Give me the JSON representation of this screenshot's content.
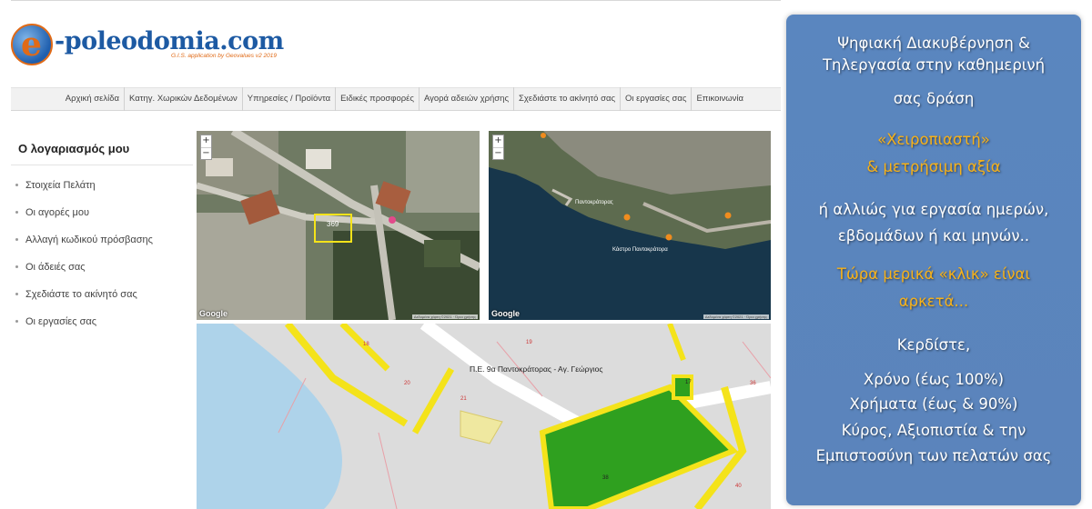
{
  "logo": {
    "text": "-poleodomia.com",
    "tagline": "G.I.S. application by Geovalues v2 2019"
  },
  "nav": {
    "items": [
      "Αρχική σελίδα",
      "Κατηγ. Χωρικών Δεδομένων",
      "Υπηρεσίες / Προϊόντα",
      "Ειδικές προσφορές",
      "Αγορά αδειών χρήσης",
      "Σχεδιάστε το ακίνητό σας",
      "Οι εργασίες σας",
      "Επικοινωνία"
    ]
  },
  "sidebar": {
    "title": "Ο λογαριασμός μου",
    "items": [
      "Στοιχεία Πελάτη",
      "Οι αγορές μου",
      "Αλλαγή κωδικού πρόσβασης",
      "Οι άδειές σας",
      "Σχεδιάστε το ακίνητό σας",
      "Οι εργασίες σας"
    ]
  },
  "maps": {
    "zoom_in": "+",
    "zoom_out": "−",
    "google": "Google",
    "attribution": "Δεδομένα χάρτη ©2021 · Όροι χρήσης",
    "satellite_left": {
      "parcel_number": "369"
    },
    "satellite_right": {
      "labels": [
        "Παντοκράτορας",
        "Κάστρο Παντοκράτορα"
      ]
    },
    "cadastral": {
      "area_label": "Π.Ε. 9α Παντοκράτορας - Αγ. Γεώργιος",
      "parcels": [
        "18",
        "19",
        "20",
        "21",
        "17",
        "36",
        "38",
        "40"
      ]
    }
  },
  "promo": {
    "line1": "Ψηφιακή Διακυβέρνηση &",
    "line2": "Τηλεργασία στην καθημερινή",
    "line3": "σας δράση",
    "line4": "«Χειροπιαστή»",
    "line5": "& μετρήσιμη αξία",
    "line6": "ή αλλιώς για εργασία ημερών,",
    "line7": "εβδομάδων ή και μηνών..",
    "line8": "Τώρα μερικά «κλικ» είναι",
    "line9": "αρκετά...",
    "line10": "Κερδίστε,",
    "line11": "Χρόνο (έως 100%)",
    "line12": "Χρήματα (έως & 90%)",
    "line13": "Κύρος, Αξιοπιστία & την",
    "line14": "Εμπιστοσύνη των πελατών σας"
  },
  "colors": {
    "promo_bg": "#5a86bf",
    "promo_highlight": "#f7b21a",
    "brand_blue": "#1d5aa3",
    "brand_orange": "#e06a17",
    "parcel_green": "#2fa01f",
    "road_yellow": "#f4e31a"
  }
}
